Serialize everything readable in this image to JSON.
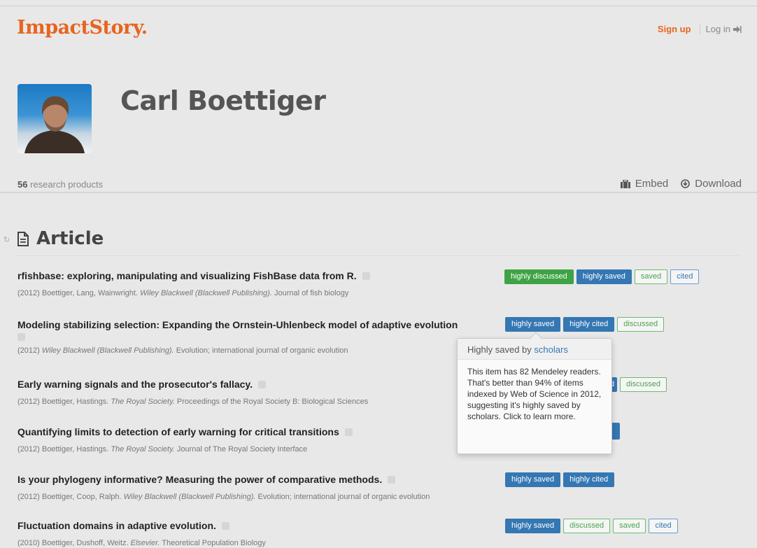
{
  "header": {
    "logo": "ImpactStory.",
    "signup": "Sign up",
    "login": "Log in"
  },
  "profile": {
    "name": "Carl Boettiger",
    "count": "56",
    "count_label": "research products",
    "embed": "Embed",
    "download": "Download"
  },
  "section": {
    "title": "Article"
  },
  "products": [
    {
      "title": "rfishbase: exploring, manipulating and visualizing FishBase data from R.",
      "meta_pre": "(2012) Boettiger, Lang, Wainwright.",
      "publisher": "Wiley Blackwell (Blackwell Publishing).",
      "journal": "Journal of fish biology",
      "badges": [
        "highly discussed",
        "highly saved",
        "saved",
        "cited"
      ]
    },
    {
      "title": "Modeling stabilizing selection: Expanding the Ornstein-Uhlenbeck model of adaptive evolution",
      "meta_pre": "(2012)",
      "publisher": "Wiley Blackwell (Blackwell Publishing).",
      "journal": "Evolution; international journal of organic evolution",
      "badges": [
        "highly saved",
        "highly cited",
        "discussed"
      ]
    },
    {
      "title": "Early warning signals and the prosecutor's fallacy.",
      "meta_pre": "(2012) Boettiger, Hastings.",
      "publisher": "The Royal Society.",
      "journal": "Proceedings of the Royal Society B: Biological Sciences",
      "badges": [
        "d",
        "discussed"
      ]
    },
    {
      "title": "Quantifying limits to detection of early warning for critical transitions",
      "meta_pre": "(2012) Boettiger, Hastings.",
      "publisher": "The Royal Society.",
      "journal": "Journal of The Royal Society Interface",
      "badges": [
        ""
      ]
    },
    {
      "title": "Is your phylogeny informative? Measuring the power of comparative methods.",
      "meta_pre": "(2012) Boettiger, Coop, Ralph.",
      "publisher": "Wiley Blackwell (Blackwell Publishing).",
      "journal": "Evolution; international journal of organic evolution",
      "badges": [
        "highly saved",
        "highly cited"
      ]
    },
    {
      "title": "Fluctuation domains in adaptive evolution.",
      "meta_pre": "(2010) Boettiger, Dushoff, Weitz.",
      "publisher": "Elsevier.",
      "journal": "Theoretical Population Biology",
      "badges": [
        "highly saved",
        "discussed",
        "saved",
        "cited"
      ]
    }
  ],
  "popover": {
    "title_pre": "Highly saved by",
    "title_link": "scholars",
    "body": "This item has 82 Mendeley readers. That's better than 94% of items indexed by Web of Science in 2012, suggesting it's highly saved by scholars. Click to learn more."
  },
  "colors": {
    "brand": "#e8641e",
    "badge_green": "#3ea345",
    "badge_blue": "#3477b3",
    "background": "#e8e8e8"
  }
}
